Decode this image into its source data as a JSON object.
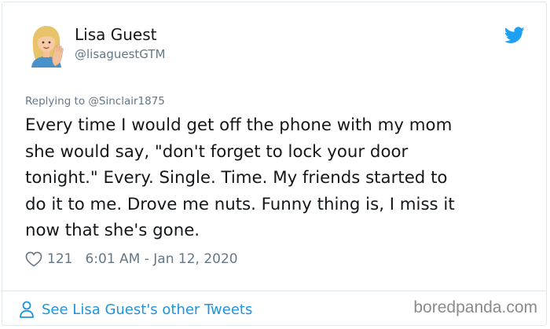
{
  "author": {
    "name": "Lisa Guest",
    "handle": "@lisaguestGTM",
    "avatar_icon": "woman-waving-emoji-icon"
  },
  "platform_icon": "twitter-bird-icon",
  "reply": {
    "prefix": "Replying to ",
    "mention": "@Sinclair1875"
  },
  "tweet": {
    "text": "Every time I would get off the phone with my mom\nshe would say, \"don't forget to lock your door\ntonight.\" Every. Single. Time. My friends started to\ndo it to me. Drove me nuts. Funny thing is, I miss it\nnow that she's gone."
  },
  "meta": {
    "like_icon": "heart-icon",
    "likes": "121",
    "timestamp": "6:01 AM - Jan 12, 2020"
  },
  "footer": {
    "link_icon": "person-icon",
    "link_text": "See Lisa Guest's other Tweets",
    "watermark": "boredpanda.com"
  },
  "colors": {
    "link_blue": "#1b95e0",
    "twitter_blue": "#1da1f2",
    "secondary_text": "#657786",
    "primary_text": "#14171a",
    "border": "#e1e8ed"
  }
}
